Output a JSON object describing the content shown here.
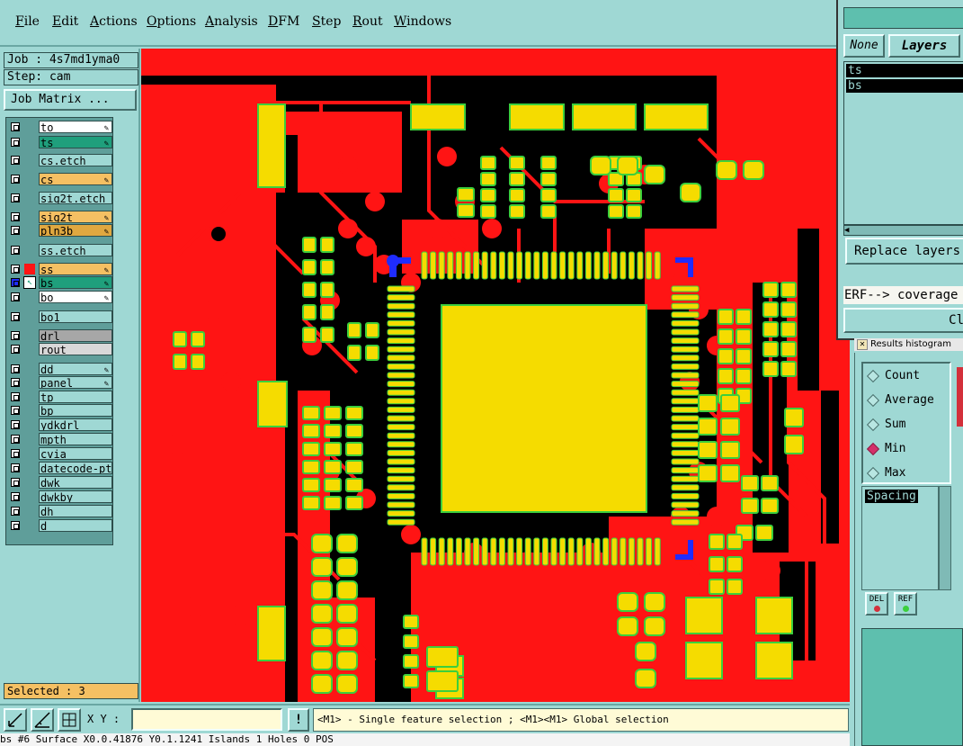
{
  "menu": [
    "File",
    "Edit",
    "Actions",
    "Options",
    "Analysis",
    "DFM",
    "Step",
    "Rout",
    "Windows"
  ],
  "job": {
    "job_label": "Job : 4s7md1yma0",
    "step_label": "Step: cam",
    "matrix_button": "Job Matrix ..."
  },
  "layers": [
    {
      "name": "to",
      "color": "#ffffff",
      "state": "none",
      "dropdown": true
    },
    {
      "name": "ts",
      "color": "#1f9f7c",
      "state": "none",
      "dropdown": true
    },
    {
      "name": "cs.etch",
      "color": "#9fd8d4",
      "state": "none",
      "dropdown": false
    },
    {
      "name": "cs",
      "color": "#f5c063",
      "state": "none",
      "dropdown": true
    },
    {
      "name": "sig2t.etch",
      "color": "#9fd8d4",
      "state": "none",
      "dropdown": false
    },
    {
      "name": "sig2t",
      "color": "#f5c063",
      "state": "none",
      "dropdown": true
    },
    {
      "name": "pln3b",
      "color": "#e0a840",
      "state": "none",
      "dropdown": true
    },
    {
      "name": "ss.etch",
      "color": "#9fd8d4",
      "state": "none",
      "dropdown": false
    },
    {
      "name": "ss",
      "color": "#f5c063",
      "state": "red",
      "dropdown": true
    },
    {
      "name": "bs",
      "color": "#1f9f7c",
      "state": "work",
      "dropdown": true
    },
    {
      "name": "bo",
      "color": "#ffffff",
      "state": "none",
      "dropdown": true
    },
    {
      "name": "bo1",
      "color": "#9fd8d4",
      "state": "none",
      "dropdown": false
    },
    {
      "name": "drl",
      "color": "#a7a7a7",
      "state": "none",
      "dropdown": false
    },
    {
      "name": "rout",
      "color": "#d8d8d8",
      "state": "none",
      "dropdown": false
    },
    {
      "name": "dd",
      "color": "#9fd8d4",
      "state": "none",
      "dropdown": true
    },
    {
      "name": "panel",
      "color": "#9fd8d4",
      "state": "none",
      "dropdown": true
    },
    {
      "name": "tp",
      "color": "#9fd8d4",
      "state": "none",
      "dropdown": false
    },
    {
      "name": "bp",
      "color": "#9fd8d4",
      "state": "none",
      "dropdown": false
    },
    {
      "name": "ydkdrl",
      "color": "#9fd8d4",
      "state": "none",
      "dropdown": false
    },
    {
      "name": "mpth",
      "color": "#9fd8d4",
      "state": "none",
      "dropdown": false
    },
    {
      "name": "cvia",
      "color": "#9fd8d4",
      "state": "none",
      "dropdown": false
    },
    {
      "name": "datecode-pte",
      "color": "#9fd8d4",
      "state": "none",
      "dropdown": false
    },
    {
      "name": "dwk",
      "color": "#9fd8d4",
      "state": "none",
      "dropdown": false
    },
    {
      "name": "dwkby",
      "color": "#9fd8d4",
      "state": "none",
      "dropdown": false
    },
    {
      "name": "dh",
      "color": "#9fd8d4",
      "state": "none",
      "dropdown": false
    },
    {
      "name": "d",
      "color": "#9fd8d4",
      "state": "none",
      "dropdown": false
    }
  ],
  "selected": "Selected : 3",
  "toolbar": {
    "xy_label": "X Y :",
    "xy_value": "",
    "bang": "!"
  },
  "hint": "<M1> - Single feature selection ; <M1><M1> Global selection",
  "status": "bs #6 Surface X0.0.41876 Y0.1.1241 Islands 1 Holes 0 POS",
  "rightpanel": {
    "none_label": "None",
    "layers_label": "Layers",
    "list": [
      "ts",
      "bs"
    ],
    "replace_label": "Replace layers",
    "erf_text": "ERF--> coverage",
    "close_label": "Cl"
  },
  "histogram": {
    "title": "Results histogram",
    "options": [
      {
        "label": "Count",
        "checked": false
      },
      {
        "label": "Average",
        "checked": false
      },
      {
        "label": "Sum",
        "checked": false
      },
      {
        "label": "Min",
        "checked": true
      },
      {
        "label": "Max",
        "checked": false
      }
    ],
    "metric": "Spacing",
    "del_label": "DEL",
    "ref_label": "REF"
  },
  "colors": {
    "copper": "#f5dc00",
    "pad_outline": "#3ccf3c",
    "plane": "#ff1414",
    "background": "#000000",
    "panel": "#9fd8d4",
    "selection": "#1f2cff"
  }
}
